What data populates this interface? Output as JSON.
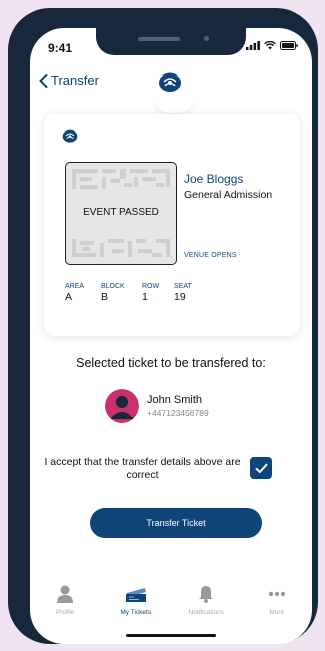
{
  "status_bar": {
    "time": "9:41"
  },
  "header": {
    "back_label": "Transfer"
  },
  "ticket": {
    "status_overlay": "EVENT PASSED",
    "holder_name": "Joe Bloggs",
    "ticket_type": "General Admission",
    "venue_opens_label": "VENUE OPENS",
    "seat_info": [
      {
        "label": "AREA",
        "value": "A"
      },
      {
        "label": "BLOCK",
        "value": "B"
      },
      {
        "label": "ROW",
        "value": "1"
      },
      {
        "label": "SEAT",
        "value": "19"
      }
    ]
  },
  "transfer": {
    "section_title": "Selected ticket to be transfered to:",
    "recipient_name": "John Smith",
    "recipient_phone": "+447123456789",
    "accept_text": "I accept that the transfer details above are correct",
    "accept_checked": true,
    "button_label": "Transfer Ticket"
  },
  "tabbar": {
    "items": [
      {
        "label": "Profile",
        "icon": "person-icon",
        "active": false
      },
      {
        "label": "My Tickets",
        "icon": "ticket-icon",
        "active": true
      },
      {
        "label": "Notifications",
        "icon": "bell-icon",
        "active": false
      },
      {
        "label": "More",
        "icon": "ellipsis-icon",
        "active": false
      }
    ]
  },
  "colors": {
    "background": "#f1e4f1",
    "phone_frame": "#17283c",
    "brand": "#0f4479",
    "avatar": "#c8306e"
  }
}
